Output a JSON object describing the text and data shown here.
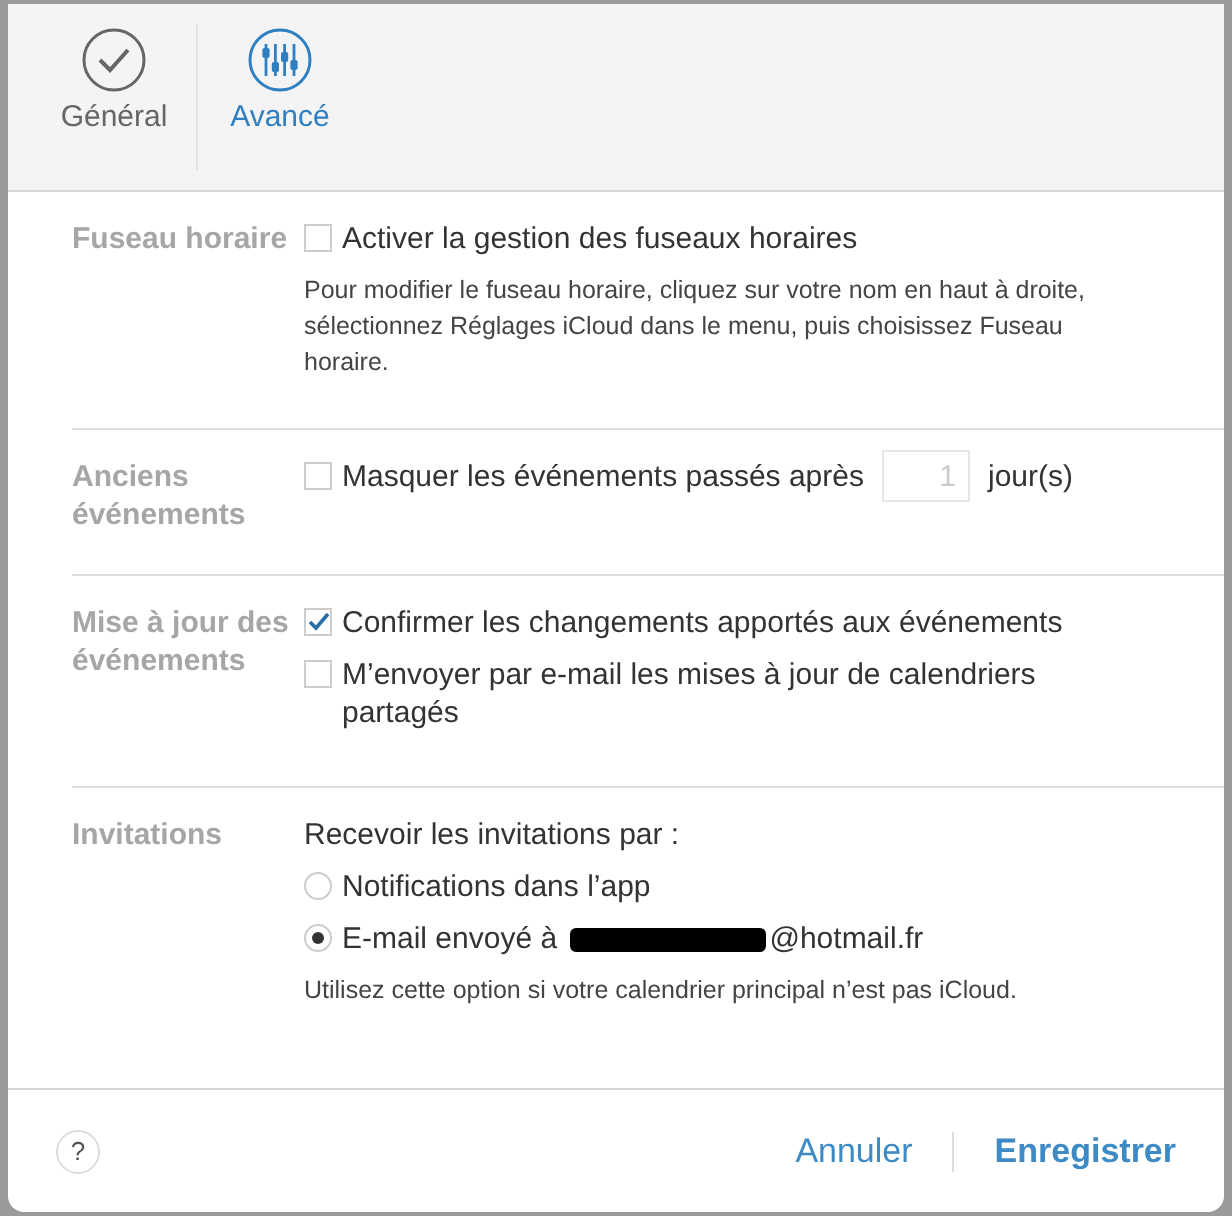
{
  "tabs": [
    {
      "label": "Général",
      "selected": false
    },
    {
      "label": "Avancé",
      "selected": true
    }
  ],
  "sections": [
    {
      "label": "Fuseau horaire",
      "items": [
        {
          "kind": "checkbox",
          "label": "Activer la gestion des fuseaux horaires",
          "checked": false
        },
        {
          "kind": "note",
          "text": "Pour modifier le fuseau horaire, cliquez sur votre nom en haut à droite, sélectionnez Réglages iCloud dans le menu, puis choisissez Fuseau horaire."
        }
      ]
    },
    {
      "label": "Anciens événements",
      "items": [
        {
          "kind": "checkbox-number",
          "label": "Masquer les événements passés après",
          "checked": false,
          "value": "1",
          "suffix": "jour(s)"
        }
      ]
    },
    {
      "label": "Mise à jour des événements",
      "items": [
        {
          "kind": "checkbox",
          "label": "Confirmer les changements apportés aux événements",
          "checked": true
        },
        {
          "kind": "checkbox",
          "label": "M’envoyer par e-mail les mises à jour de calendriers partagés",
          "checked": false
        }
      ]
    },
    {
      "label": "Invitations",
      "items": [
        {
          "kind": "text",
          "text": "Recevoir les invitations par :"
        },
        {
          "kind": "radio",
          "label": "Notifications dans l’app",
          "selected": false
        },
        {
          "kind": "radio",
          "label": "E-mail envoyé à",
          "redacted": true,
          "suffix": "@hotmail.fr",
          "selected": true
        },
        {
          "kind": "note",
          "text": "Utilisez cette option si votre calendrier principal n’est pas iCloud."
        }
      ]
    }
  ],
  "footer": {
    "help": "?",
    "cancel": "Annuler",
    "save": "Enregistrer"
  }
}
